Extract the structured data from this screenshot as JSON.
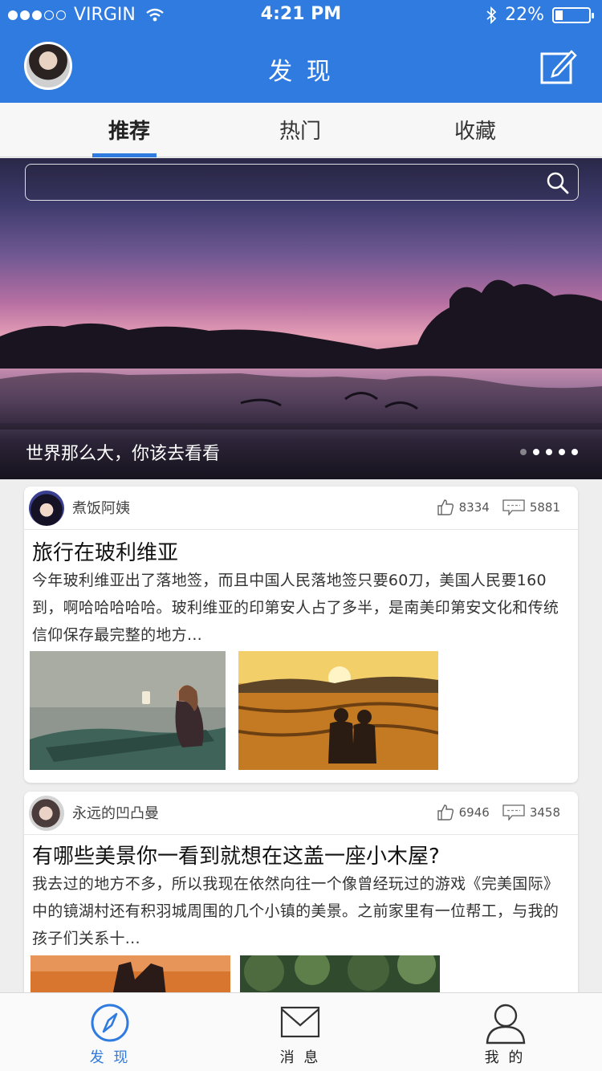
{
  "status_bar": {
    "carrier": "VIRGIN",
    "time": "4:21 PM",
    "battery": "22%",
    "battery_level": 0.22
  },
  "nav": {
    "title": "发 现"
  },
  "tabs": [
    {
      "label": "推荐",
      "active": true
    },
    {
      "label": "热门",
      "active": false
    },
    {
      "label": "收藏",
      "active": false
    }
  ],
  "banner": {
    "caption": "世界那么大，你该去看看",
    "page_count": 5,
    "current_page": 1
  },
  "posts": [
    {
      "author": "煮饭阿姨",
      "likes": "8334",
      "comments": "5881",
      "title": "旅行在玻利维亚",
      "body": "今年玻利维亚出了落地签，而且中国人民落地签只要60刀，美国人民要160到，啊哈哈哈哈哈。玻利维亚的印第安人占了多半，是南美印第安文化和传统信仰保存最完整的地方..."
    },
    {
      "author": "永远的凹凸曼",
      "likes": "6946",
      "comments": "3458",
      "title": "有哪些美景你一看到就想在这盖一座小木屋?",
      "body": "我去过的地方不多，所以我现在依然向往一个像曾经玩过的游戏《完美国际》中的镜湖村还有积羽城周围的几个小镇的美景。之前家里有一位帮工，与我的孩子们关系十..."
    }
  ],
  "bottom_tabs": [
    {
      "label": "发 现",
      "active": true
    },
    {
      "label": "消 息",
      "active": false
    },
    {
      "label": "我 的",
      "active": false
    }
  ],
  "colors": {
    "primary": "#2f7be0"
  },
  "icons": {
    "wifi": "wifi-icon",
    "bluetooth": "bluetooth-icon",
    "edit": "edit-icon",
    "search": "search-icon",
    "like": "thumbs-up-icon",
    "comment": "comment-icon",
    "compass": "compass-icon",
    "mail": "mail-icon",
    "person": "person-icon"
  }
}
